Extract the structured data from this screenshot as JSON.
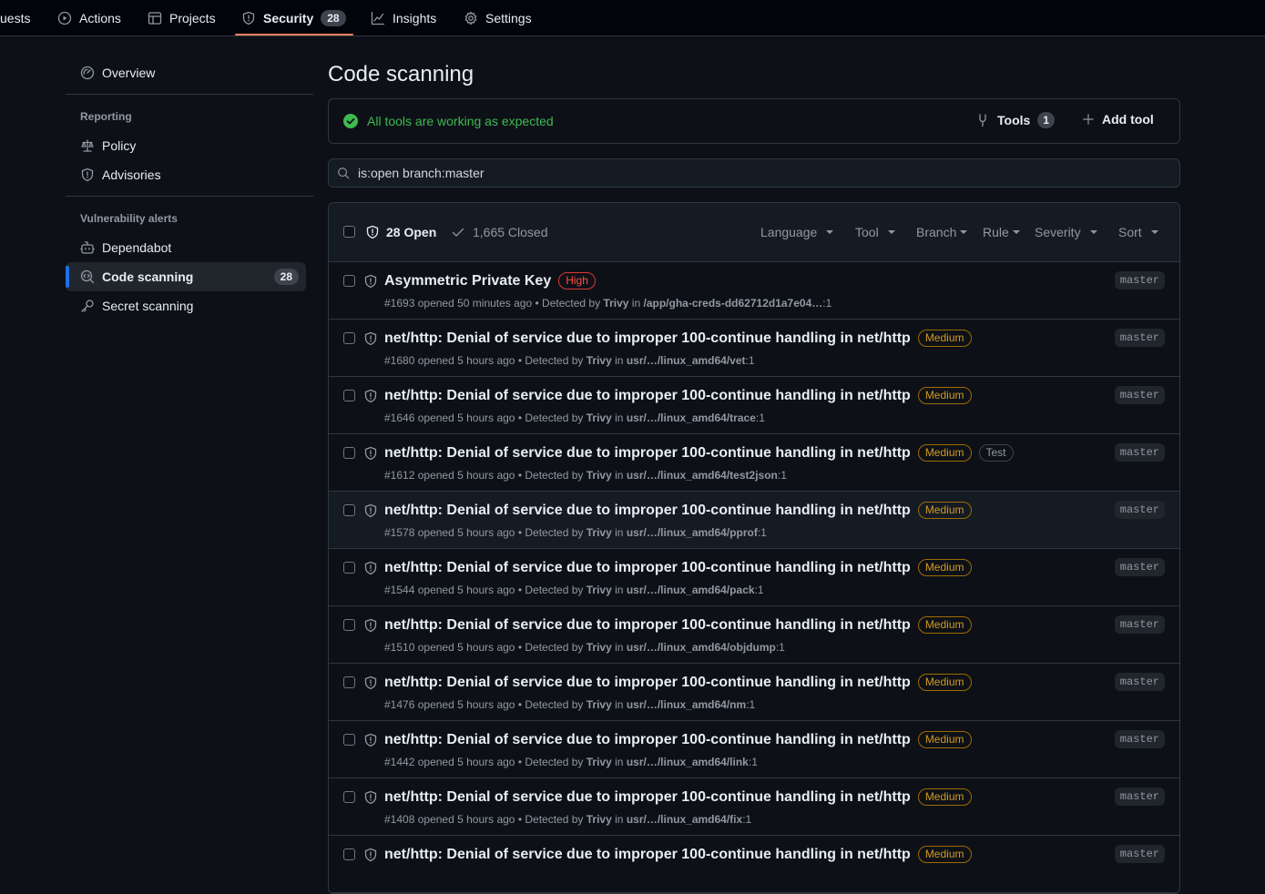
{
  "topnav": {
    "items": [
      {
        "label": "uests",
        "icon": "pull-request-icon"
      },
      {
        "label": "Actions",
        "icon": "play-icon"
      },
      {
        "label": "Projects",
        "icon": "table-icon"
      },
      {
        "label": "Security",
        "icon": "shield-icon",
        "count": "28",
        "active": true
      },
      {
        "label": "Insights",
        "icon": "graph-icon"
      },
      {
        "label": "Settings",
        "icon": "gear-icon"
      }
    ]
  },
  "sidebar": {
    "overview": "Overview",
    "reporting_heading": "Reporting",
    "policy": "Policy",
    "advisories": "Advisories",
    "vuln_heading": "Vulnerability alerts",
    "dependabot": "Dependabot",
    "code_scanning": "Code scanning",
    "code_scanning_count": "28",
    "secret_scanning": "Secret scanning"
  },
  "main": {
    "title": "Code scanning",
    "tools_status": "All tools are working as expected",
    "tools_label": "Tools",
    "tools_count": "1",
    "add_tool": "Add tool",
    "search_value": "is:open branch:master",
    "open_label": "28 Open",
    "closed_label": "1,665 Closed",
    "filters": [
      "Language",
      "Tool",
      "Branch",
      "Rule",
      "Severity",
      "Sort"
    ]
  },
  "alerts": [
    {
      "title": "Asymmetric Private Key",
      "severity": "High",
      "tag": "",
      "number": "#1693",
      "opened": "opened 50 minutes ago",
      "detected_by": "Detected by",
      "tool": "Trivy",
      "in": "in",
      "path": "/app/gha-creds-dd62712d1a7e04…",
      "line": ":1",
      "branch": "master"
    },
    {
      "title": "net/http: Denial of service due to improper 100-continue handling in net/http",
      "severity": "Medium",
      "tag": "",
      "number": "#1680",
      "opened": "opened 5 hours ago",
      "detected_by": "Detected by",
      "tool": "Trivy",
      "in": "in",
      "path": "usr/…/linux_amd64/vet",
      "line": ":1",
      "branch": "master"
    },
    {
      "title": "net/http: Denial of service due to improper 100-continue handling in net/http",
      "severity": "Medium",
      "tag": "",
      "number": "#1646",
      "opened": "opened 5 hours ago",
      "detected_by": "Detected by",
      "tool": "Trivy",
      "in": "in",
      "path": "usr/…/linux_amd64/trace",
      "line": ":1",
      "branch": "master"
    },
    {
      "title": "net/http: Denial of service due to improper 100-continue handling in net/http",
      "severity": "Medium",
      "tag": "Test",
      "number": "#1612",
      "opened": "opened 5 hours ago",
      "detected_by": "Detected by",
      "tool": "Trivy",
      "in": "in",
      "path": "usr/…/linux_amd64/test2json",
      "line": ":1",
      "branch": "master"
    },
    {
      "title": "net/http: Denial of service due to improper 100-continue handling in net/http",
      "severity": "Medium",
      "tag": "",
      "number": "#1578",
      "opened": "opened 5 hours ago",
      "detected_by": "Detected by",
      "tool": "Trivy",
      "in": "in",
      "path": "usr/…/linux_amd64/pprof",
      "line": ":1",
      "branch": "master"
    },
    {
      "title": "net/http: Denial of service due to improper 100-continue handling in net/http",
      "severity": "Medium",
      "tag": "",
      "number": "#1544",
      "opened": "opened 5 hours ago",
      "detected_by": "Detected by",
      "tool": "Trivy",
      "in": "in",
      "path": "usr/…/linux_amd64/pack",
      "line": ":1",
      "branch": "master"
    },
    {
      "title": "net/http: Denial of service due to improper 100-continue handling in net/http",
      "severity": "Medium",
      "tag": "",
      "number": "#1510",
      "opened": "opened 5 hours ago",
      "detected_by": "Detected by",
      "tool": "Trivy",
      "in": "in",
      "path": "usr/…/linux_amd64/objdump",
      "line": ":1",
      "branch": "master"
    },
    {
      "title": "net/http: Denial of service due to improper 100-continue handling in net/http",
      "severity": "Medium",
      "tag": "",
      "number": "#1476",
      "opened": "opened 5 hours ago",
      "detected_by": "Detected by",
      "tool": "Trivy",
      "in": "in",
      "path": "usr/…/linux_amd64/nm",
      "line": ":1",
      "branch": "master"
    },
    {
      "title": "net/http: Denial of service due to improper 100-continue handling in net/http",
      "severity": "Medium",
      "tag": "",
      "number": "#1442",
      "opened": "opened 5 hours ago",
      "detected_by": "Detected by",
      "tool": "Trivy",
      "in": "in",
      "path": "usr/…/linux_amd64/link",
      "line": ":1",
      "branch": "master"
    },
    {
      "title": "net/http: Denial of service due to improper 100-continue handling in net/http",
      "severity": "Medium",
      "tag": "",
      "number": "#1408",
      "opened": "opened 5 hours ago",
      "detected_by": "Detected by",
      "tool": "Trivy",
      "in": "in",
      "path": "usr/…/linux_amd64/fix",
      "line": ":1",
      "branch": "master"
    },
    {
      "title": "net/http: Denial of service due to improper 100-continue handling in net/http",
      "severity": "Medium",
      "tag": "",
      "number": "",
      "opened": "",
      "detected_by": "",
      "tool": "",
      "in": "",
      "path": "",
      "line": "",
      "branch": "master"
    }
  ],
  "colors": {
    "accent": "#1f6feb",
    "success": "#3fb950",
    "high": "#f85149",
    "medium": "#d29922",
    "underline": "#f78166"
  }
}
